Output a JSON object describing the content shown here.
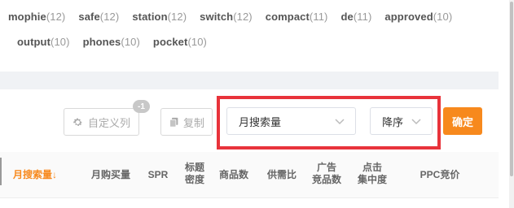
{
  "keyword_tags": {
    "row1": [
      {
        "word": "mophie",
        "count": "(12)"
      },
      {
        "word": "safe",
        "count": "(12)"
      },
      {
        "word": "station",
        "count": "(12)"
      },
      {
        "word": "switch",
        "count": "(12)"
      },
      {
        "word": "compact",
        "count": "(11)"
      },
      {
        "word": "de",
        "count": "(11)"
      },
      {
        "word": "approved",
        "count": "(10)"
      }
    ],
    "row2": [
      {
        "word": "output",
        "count": "(10)"
      },
      {
        "word": "phones",
        "count": "(10)"
      },
      {
        "word": "pocket",
        "count": "(10)"
      }
    ]
  },
  "toolbar": {
    "custom_columns_label": "自定义列",
    "custom_columns_badge": "-1",
    "copy_label": "复制",
    "sort_field_selected": "月搜索量",
    "sort_order_selected": "降序",
    "confirm_label": "确定"
  },
  "table": {
    "headers": [
      {
        "line1": "月搜索量↓"
      },
      {
        "line1": "月购买量"
      },
      {
        "line1": "SPR"
      },
      {
        "line1": "标题",
        "line2": "密度"
      },
      {
        "line1": "商品数"
      },
      {
        "line1": "供需比"
      },
      {
        "line1": "广告",
        "line2": "竞品数"
      },
      {
        "line1": "点击",
        "line2": "集中度"
      },
      {
        "line1": "PPC竞价"
      }
    ]
  },
  "colors": {
    "accent": "#f7891d",
    "highlight": "#e8333b"
  },
  "icons": {
    "custom_columns": "gear-icon",
    "copy": "copy-icon",
    "dropdown": "chevron-down-icon"
  }
}
